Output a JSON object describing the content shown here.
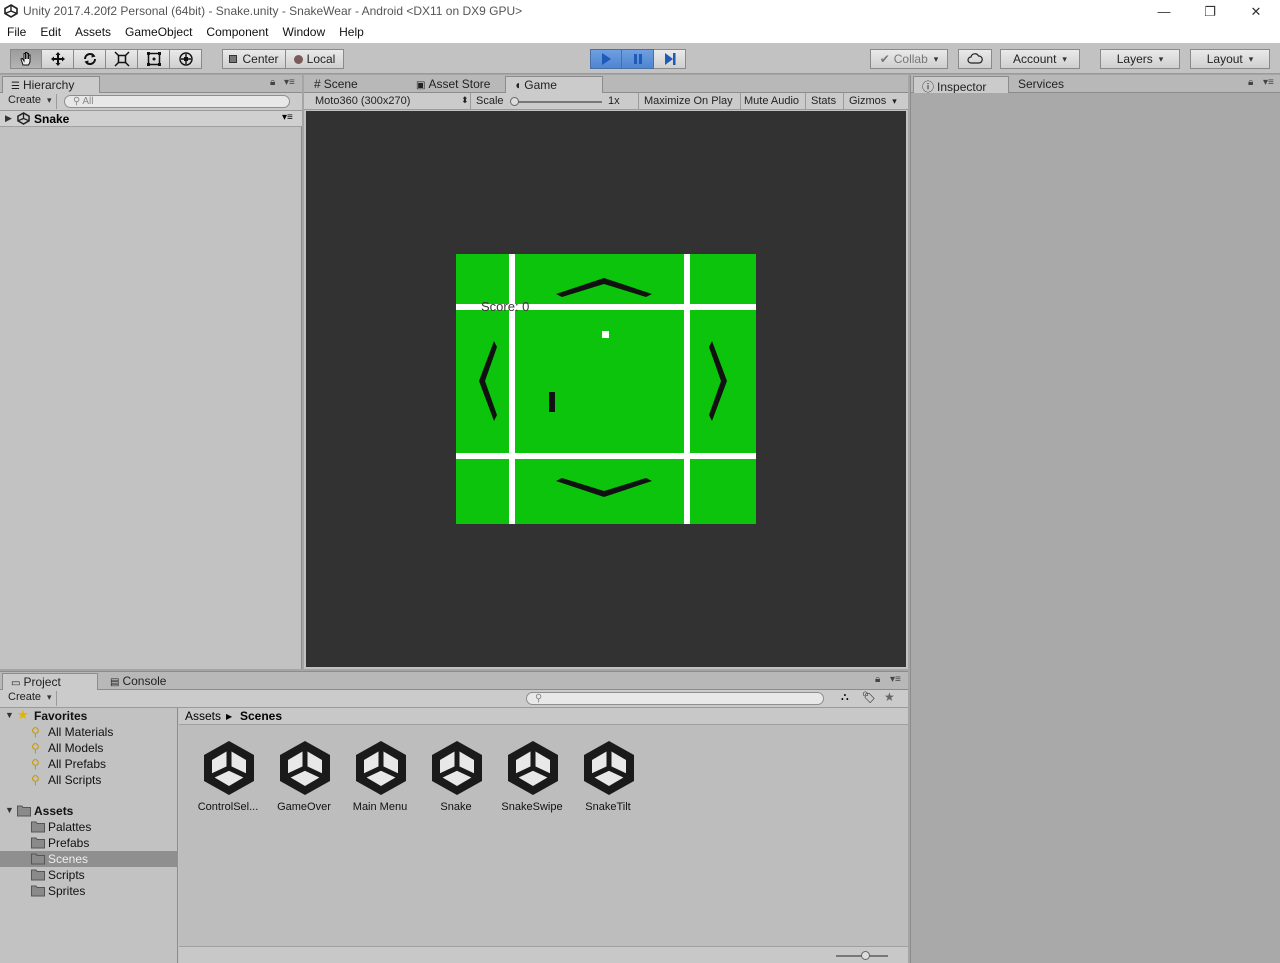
{
  "window": {
    "title": "Unity 2017.4.20f2 Personal (64bit) - Snake.unity - SnakeWear - Android <DX11 on DX9 GPU>"
  },
  "menu": [
    "File",
    "Edit",
    "Assets",
    "GameObject",
    "Component",
    "Window",
    "Help"
  ],
  "toolbar": {
    "pivot_label": "Center",
    "space_label": "Local",
    "collab_label": "Collab",
    "account_label": "Account",
    "layers_label": "Layers",
    "layout_label": "Layout"
  },
  "hierarchy": {
    "tab": "Hierarchy",
    "create": "Create",
    "search_placeholder": "All",
    "scene_name": "Snake"
  },
  "center_tabs": [
    "Scene",
    "Asset Store",
    "Game"
  ],
  "game": {
    "resolution": "Moto360 (300x270)",
    "scale_label": "Scale",
    "scale_value": "1x",
    "maximize_on_play": "Maximize On Play",
    "mute_audio": "Mute Audio",
    "stats": "Stats",
    "gizmos": "Gizmos",
    "score_text": "Score: 0"
  },
  "inspector_tabs": [
    "Inspector",
    "Services"
  ],
  "project": {
    "tabs": [
      "Project",
      "Console"
    ],
    "create": "Create",
    "favorites_label": "Favorites",
    "favorites": [
      "All Materials",
      "All Models",
      "All Prefabs",
      "All Scripts"
    ],
    "assets_label": "Assets",
    "folders": [
      "Palattes",
      "Prefabs",
      "Scenes",
      "Scripts",
      "Sprites"
    ],
    "selected_folder": "Scenes",
    "breadcrumb": [
      "Assets",
      "Scenes"
    ],
    "scenes": [
      "ControlSel...",
      "GameOver",
      "Main Menu",
      "Snake",
      "SnakeSwipe",
      "SnakeTilt"
    ]
  },
  "colors": {
    "game_green": "#0cc40c",
    "game_view_bg": "#323232",
    "play_blue": "#4f85d0"
  }
}
